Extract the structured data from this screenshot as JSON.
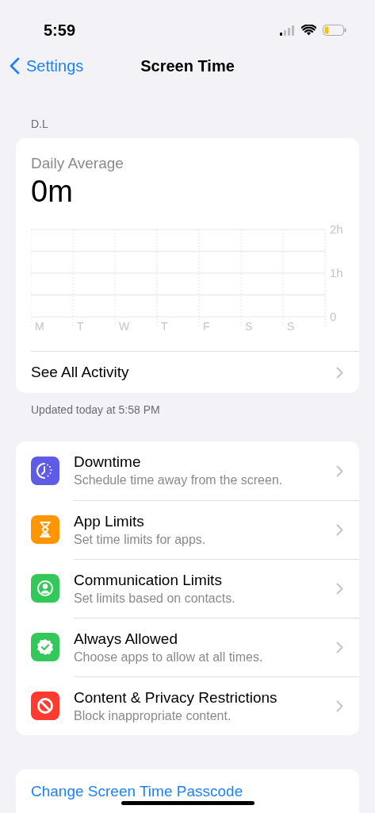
{
  "status_bar": {
    "time": "5:59"
  },
  "nav": {
    "back": "Settings",
    "title": "Screen Time"
  },
  "section_label": "D.L",
  "summary": {
    "title": "Daily Average",
    "value": "0m",
    "chart_data": {
      "type": "bar",
      "categories": [
        "M",
        "T",
        "W",
        "T",
        "F",
        "S",
        "S"
      ],
      "values": [
        0,
        0,
        0,
        0,
        0,
        0,
        0
      ],
      "ylim": [
        0,
        2
      ],
      "yticks": [
        {
          "value": 0,
          "label": "0"
        },
        {
          "value": 1,
          "label": "1h"
        },
        {
          "value": 2,
          "label": "2h"
        }
      ]
    },
    "link": "See All Activity"
  },
  "updated": "Updated today at 5:58 PM",
  "items": [
    {
      "kind": "downtime",
      "color": "#5e5ce6",
      "title": "Downtime",
      "subtitle": "Schedule time away from the screen."
    },
    {
      "kind": "hourglass",
      "color": "#ff9500",
      "title": "App Limits",
      "subtitle": "Set time limits for apps."
    },
    {
      "kind": "person",
      "color": "#34c759",
      "title": "Communication Limits",
      "subtitle": "Set limits based on contacts."
    },
    {
      "kind": "badge",
      "color": "#34c759",
      "title": "Always Allowed",
      "subtitle": "Choose apps to allow at all times."
    },
    {
      "kind": "noentry",
      "color": "#ff3b30",
      "title": "Content & Privacy Restrictions",
      "subtitle": "Block inappropriate content."
    }
  ],
  "passcode_link": "Change Screen Time Passcode"
}
